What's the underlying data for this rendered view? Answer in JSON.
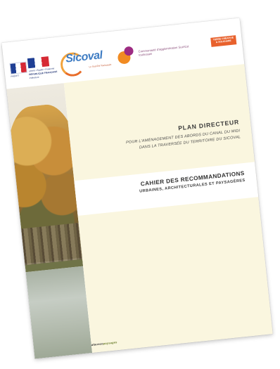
{
  "logos": {
    "gov_lines": [
      "PRÉFET",
      "Liberté • Égalité • Fraternité",
      "RÉPUBLIQUE FRANÇAISE",
      "Préfecture"
    ],
    "sicoval_name": "Sicoval",
    "sicoval_tagline": "Le Sud-Est Toulousain",
    "agglo_text": "Communauté d'agglomération Sud-Est toulousain",
    "terre_badge": [
      "TERRE CRÉATIVE",
      "& SOLIDAIRE"
    ]
  },
  "cover": {
    "plan_title": "PLAN DIRECTEUR",
    "plan_subtitle_lines": [
      "POUR L'AMÉNAGEMENT DES ABORDS DU CANAL DU MIDI",
      "DANS LA TRAVERSÉE DU TERRITOIRE DU SICOVAL"
    ],
    "cahier_title": "CAHIER DES RECOMMANDATIONS",
    "cahier_subtitle": "URBAINES, ARCHITECTURALES ET PAYSAGÈRES"
  },
  "footer": {
    "logo_text": "altereco",
    "logo_text_italic": "paysages"
  },
  "colors": {
    "panel": "#faf6df",
    "accent_orange": "#e8612c",
    "sicoval_blue": "#3e7cc3",
    "agglo_purple": "#9d2b82"
  }
}
